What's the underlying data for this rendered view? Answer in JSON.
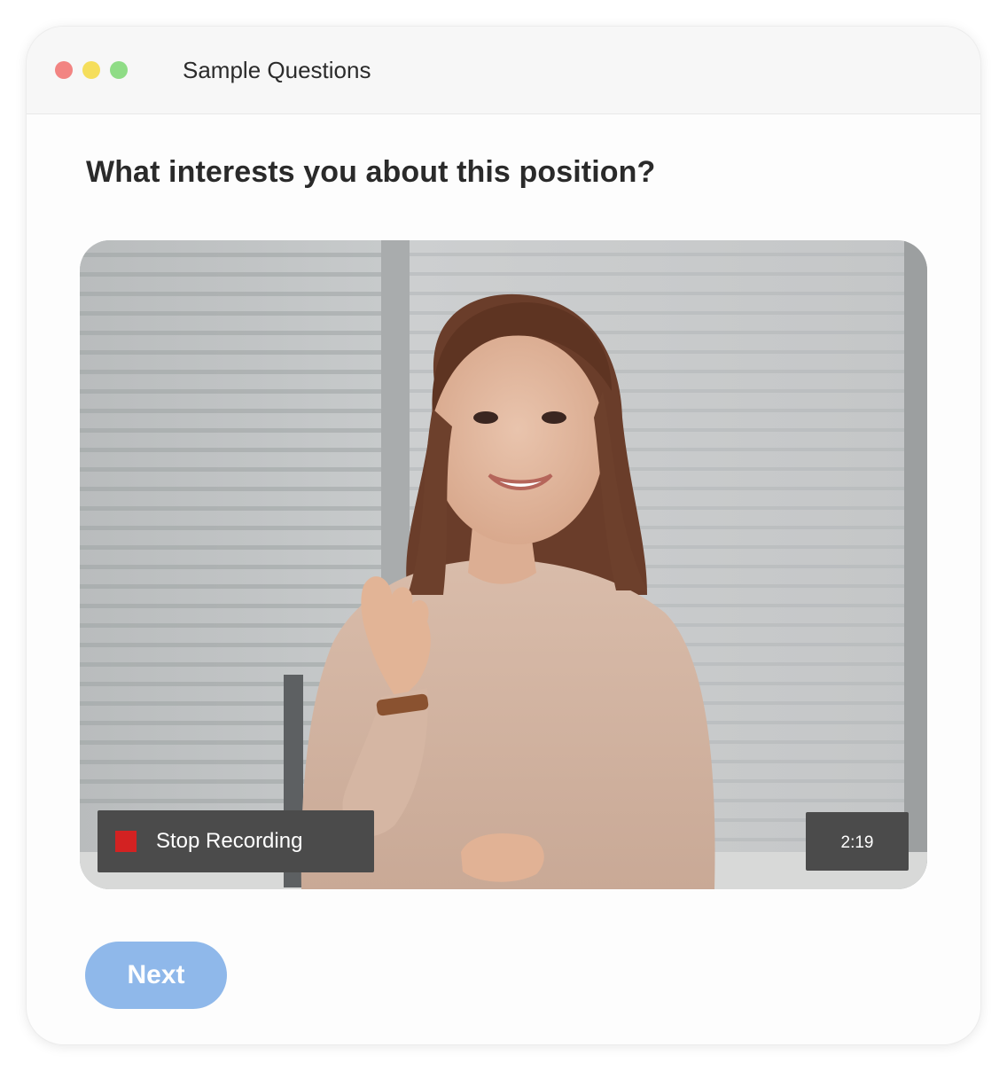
{
  "window": {
    "title": "Sample Questions",
    "controls": {
      "close_color": "#f28482",
      "minimize_color": "#f5de5c",
      "maximize_color": "#8fdc86"
    }
  },
  "question": {
    "text": "What interests you about this position?"
  },
  "video": {
    "stop_button_label": "Stop Recording",
    "stop_indicator_color": "#d32222",
    "timer": "2:19"
  },
  "footer": {
    "next_label": "Next",
    "next_color": "#8fb8ea"
  }
}
